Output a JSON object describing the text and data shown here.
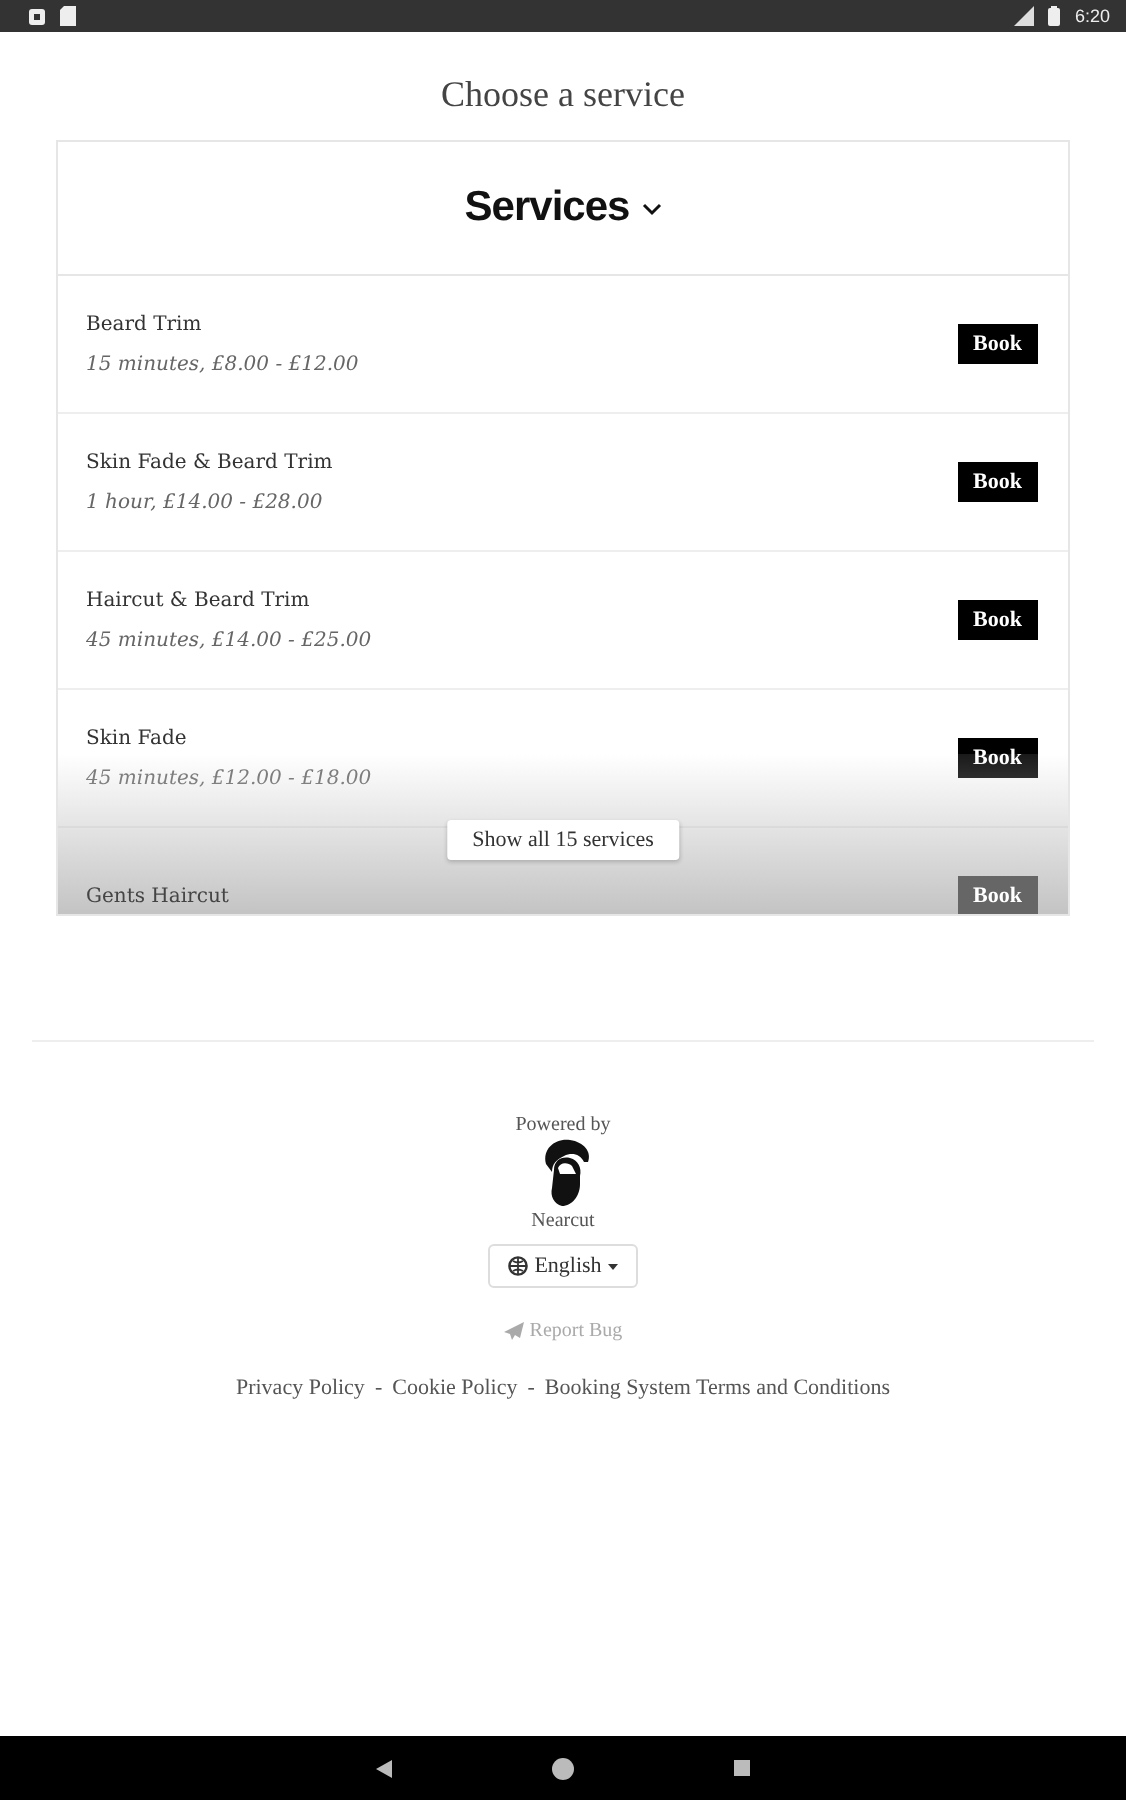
{
  "status_bar": {
    "time": "6:20"
  },
  "page_title": "Choose a service",
  "services_header": {
    "label": "Services",
    "expanded": false
  },
  "services": [
    {
      "name": "Beard Trim",
      "details": "15 minutes, £8.00 - £12.00",
      "button": "Book",
      "faded": false
    },
    {
      "name": "Skin Fade & Beard Trim",
      "details": "1 hour, £14.00 - £28.00",
      "button": "Book",
      "faded": false
    },
    {
      "name": "Haircut & Beard Trim",
      "details": "45 minutes, £14.00 - £25.00",
      "button": "Book",
      "faded": false
    },
    {
      "name": "Skin Fade",
      "details": "45 minutes, £12.00 - £18.00",
      "button": "Book",
      "faded": false
    },
    {
      "name": "Gents Haircut",
      "button": "Book",
      "faded": true
    }
  ],
  "show_all_button": "Show all 15 services",
  "footer": {
    "powered_by": "Powered by",
    "brand": "Nearcut",
    "language": "English",
    "report_bug": "Report Bug",
    "links": [
      "Privacy Policy",
      "Cookie Policy",
      "Booking System Terms and Conditions"
    ],
    "separators": [
      "-",
      "-"
    ]
  }
}
